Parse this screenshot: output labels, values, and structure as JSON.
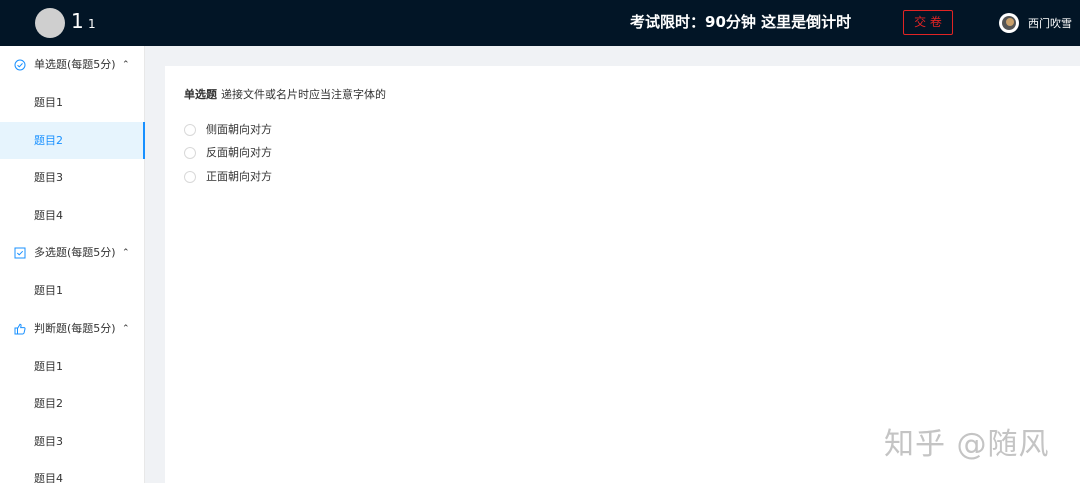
{
  "header": {
    "brand": "1",
    "brand_sub": "1",
    "timer": "考试限时：90分钟 这里是倒计时",
    "submit_label": "交 卷",
    "user_name": "西门吹雪"
  },
  "sidebar": {
    "groups": [
      {
        "title": "单选题(每题5分)",
        "icon": "check-circle-icon",
        "items": [
          "题目1",
          "题目2",
          "题目3",
          "题目4"
        ],
        "active_index": 1
      },
      {
        "title": "多选题(每题5分)",
        "icon": "checkbox-icon",
        "items": [
          "题目1"
        ]
      },
      {
        "title": "判断题(每题5分)",
        "icon": "thumbs-up-icon",
        "items": [
          "题目1",
          "题目2",
          "题目3",
          "题目4"
        ]
      }
    ]
  },
  "question": {
    "type": "单选题",
    "text": "递接文件或名片时应当注意字体的",
    "options": [
      "侧面朝向对方",
      "反面朝向对方",
      "正面朝向对方"
    ]
  },
  "watermark": "知乎 @随风",
  "colors": {
    "header_bg": "#021526",
    "accent": "#1890ff",
    "danger": "#e02424"
  }
}
